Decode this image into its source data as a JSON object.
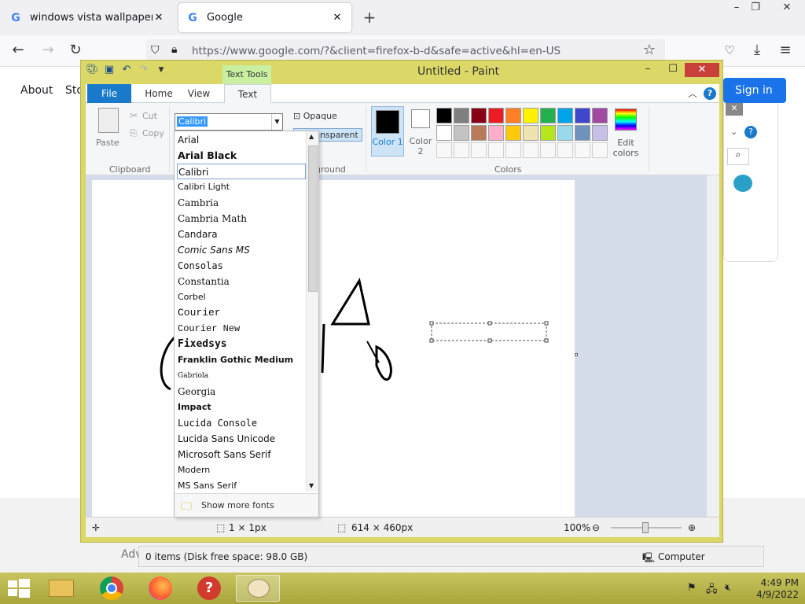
{
  "browser": {
    "tabs": [
      {
        "title": "windows vista wallpaper - Goog",
        "active": false
      },
      {
        "title": "Google",
        "active": true
      }
    ],
    "url": "https://www.google.com/?&client=firefox-b-d&safe=active&hl=en-US"
  },
  "google_page": {
    "about": "About",
    "store": "Sto",
    "sign_in": "Sign in",
    "advertising": "Adv"
  },
  "explorer_status": {
    "items": "0 items (Disk free space: 98.0 GB)",
    "location": "Computer"
  },
  "paint": {
    "title": "Untitled - Paint",
    "context_tab": "Text Tools",
    "tabs": [
      "File",
      "Home",
      "View",
      "Text"
    ],
    "clipboard": {
      "paste": "Paste",
      "cut": "Cut",
      "copy": "Copy",
      "group": "Clipboard"
    },
    "font_value": "Calibri",
    "background": {
      "opaque": "Opaque",
      "transparent": "Transparent",
      "group": "ground"
    },
    "colors": {
      "color1": "Color 1",
      "color2": "Color 2",
      "edit": "Edit colors",
      "group": "Colors",
      "palette_row1": [
        "#000000",
        "#7f7f7f",
        "#880015",
        "#ed1c24",
        "#ff7f27",
        "#fff200",
        "#22b14c",
        "#00a2e8",
        "#3f48cc",
        "#a349a4"
      ],
      "palette_row2": [
        "#ffffff",
        "#c3c3c3",
        "#b97a57",
        "#ffaec9",
        "#ffc90e",
        "#efe4b0",
        "#b5e61d",
        "#99d9ea",
        "#7092be",
        "#c8bfe7"
      ]
    },
    "status": {
      "selection": "1 × 1px",
      "size": "614 × 460px",
      "zoom": "100%"
    }
  },
  "font_list": {
    "items": [
      "Arial",
      "Arial Black",
      "Calibri",
      "Calibri Light",
      "Cambria",
      "Cambria Math",
      "Candara",
      "Comic Sans MS",
      "Consolas",
      "Constantia",
      "Corbel",
      "Courier",
      "Courier New",
      "Fixedsys",
      "Franklin Gothic Medium",
      "Gabriola",
      "Georgia",
      "Impact",
      "Lucida Console",
      "Lucida Sans Unicode",
      "Microsoft Sans Serif",
      "Modern",
      "MS Sans Serif"
    ],
    "selected": "Calibri",
    "show_more": "Show more fonts"
  },
  "taskbar": {
    "time": "4:49 PM",
    "date": "4/9/2022"
  }
}
